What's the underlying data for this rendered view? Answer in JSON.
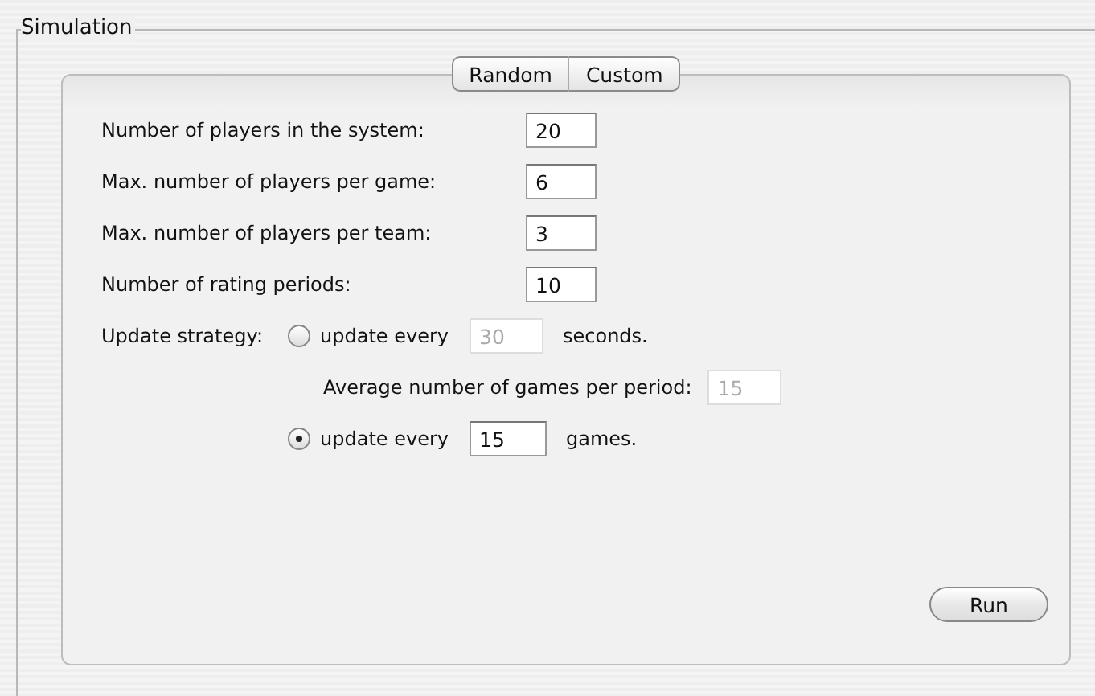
{
  "group": {
    "title": "Simulation"
  },
  "tabs": [
    {
      "label": "Random",
      "selected": false
    },
    {
      "label": "Custom",
      "selected": false
    }
  ],
  "fields": [
    {
      "label": "Number of players in the system:",
      "value": "20"
    },
    {
      "label": "Max. number of players per game:",
      "value": "6"
    },
    {
      "label": "Max. number of players per team:",
      "value": "3"
    },
    {
      "label": "Number of rating periods:",
      "value": "10"
    }
  ],
  "strategy": {
    "label": "Update strategy:",
    "time_option": {
      "selected": false,
      "prefix": "update every",
      "value": "30",
      "disabled": true,
      "suffix": "seconds."
    },
    "average": {
      "label": "Average number of games per period:",
      "value": "15",
      "disabled": true
    },
    "games_option": {
      "selected": true,
      "prefix": "update every",
      "value": "15",
      "disabled": false,
      "suffix": "games."
    }
  },
  "run_button": {
    "label": "Run"
  }
}
